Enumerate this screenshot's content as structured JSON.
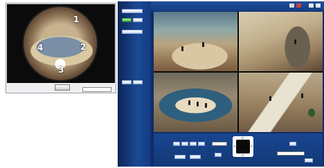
{
  "fisheye": {
    "region_labels": [
      "1",
      "2",
      "3",
      "4"
    ],
    "bottom_button_label": "",
    "select_label": "",
    "select_value": ""
  },
  "camera_ui": {
    "title": "",
    "sidebar": {
      "labels": [
        "",
        "",
        "",
        "",
        ""
      ],
      "buttons": [
        "",
        "",
        "",
        ""
      ]
    },
    "tiles": [
      "view-1",
      "view-2",
      "view-3",
      "view-4"
    ]
  },
  "colors": {
    "panel_blue": "#0e2c6a",
    "accent_green": "#3bb03b"
  }
}
